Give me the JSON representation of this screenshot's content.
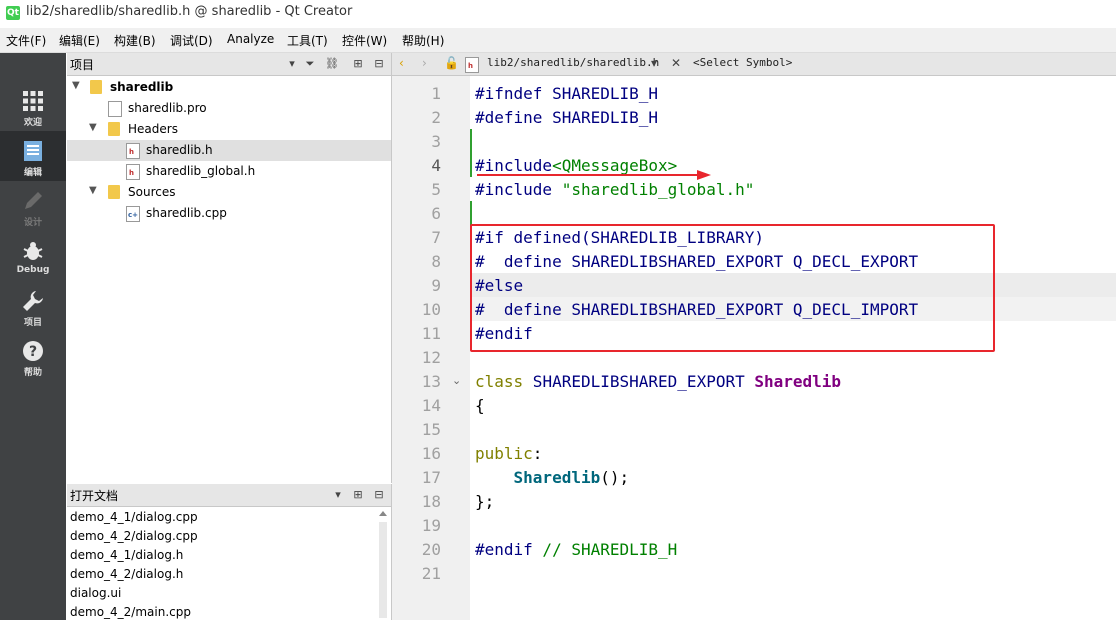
{
  "window": {
    "title": "lib2/sharedlib/sharedlib.h @ sharedlib - Qt Creator",
    "app_icon": "Qt"
  },
  "menu": [
    {
      "label": "文件(F)"
    },
    {
      "label": "编辑(E)"
    },
    {
      "label": "构建(B)"
    },
    {
      "label": "调试(D)"
    },
    {
      "label": "Analyze"
    },
    {
      "label": "工具(T)"
    },
    {
      "label": "控件(W)"
    },
    {
      "label": "帮助(H)"
    }
  ],
  "modes": [
    {
      "label": "欢迎",
      "icon": "grid-icon",
      "state": "normal"
    },
    {
      "label": "编辑",
      "icon": "edit-doc-icon",
      "state": "active"
    },
    {
      "label": "设计",
      "icon": "pencil-icon",
      "state": "disabled"
    },
    {
      "label": "Debug",
      "icon": "bug-icon",
      "state": "normal"
    },
    {
      "label": "项目",
      "icon": "wrench-icon",
      "state": "normal"
    },
    {
      "label": "帮助",
      "icon": "help-icon",
      "state": "normal"
    }
  ],
  "project_panel": {
    "title": "项目",
    "tree": [
      {
        "label": "sharedlib",
        "type": "project",
        "expanded": true
      },
      {
        "label": "sharedlib.pro",
        "type": "pro-file"
      },
      {
        "label": "Headers",
        "type": "folder",
        "expanded": true
      },
      {
        "label": "sharedlib.h",
        "type": "header-file",
        "selected": true
      },
      {
        "label": "sharedlib_global.h",
        "type": "header-file"
      },
      {
        "label": "Sources",
        "type": "folder",
        "expanded": true
      },
      {
        "label": "sharedlib.cpp",
        "type": "source-file"
      }
    ]
  },
  "open_docs_panel": {
    "title": "打开文档",
    "items": [
      {
        "label": "demo_4_1/dialog.cpp"
      },
      {
        "label": "demo_4_2/dialog.cpp"
      },
      {
        "label": "demo_4_1/dialog.h"
      },
      {
        "label": "demo_4_2/dialog.h"
      },
      {
        "label": "dialog.ui"
      },
      {
        "label": "demo_4_2/main.cpp"
      }
    ]
  },
  "editor_toolbar": {
    "file_path": "lib2/sharedlib/sharedlib.h",
    "symbol": "<Select Symbol>"
  },
  "editor": {
    "current_line": 4,
    "line_numbers": [
      "1",
      "2",
      "3",
      "4",
      "5",
      "6",
      "7",
      "8",
      "9",
      "10",
      "11",
      "12",
      "13",
      "14",
      "15",
      "16",
      "17",
      "18",
      "19",
      "20",
      "21"
    ],
    "lines": {
      "l1a": "#ifndef",
      "l1b": " SHAREDLIB_H",
      "l2a": "#define",
      "l2b": " SHAREDLIB_H",
      "l4a": "#include",
      "l4b": "<QMessageBox>",
      "l5a": "#include",
      "l5b": " \"sharedlib_global.h\"",
      "l7": "#if defined(SHAREDLIB_LIBRARY)",
      "l8a": "#  define",
      "l8b": " SHAREDLIBSHARED_EXPORT Q_DECL_EXPORT",
      "l9": "#else",
      "l10a": "#  define",
      "l10b": " SHAREDLIBSHARED_EXPORT Q_DECL_IMPORT",
      "l11": "#endif",
      "l13a": "class",
      "l13b": " SHAREDLIBSHARED_EXPORT ",
      "l13c": "Sharedlib",
      "l14": "{",
      "l16a": "public",
      "l16b": ":",
      "l17a": "    ",
      "l17b": "Sharedlib",
      "l17c": "();",
      "l18": "};",
      "l20a": "#endif",
      "l20b": " // SHAREDLIB_H"
    }
  },
  "colors": {
    "annotation_red": "#e8262d",
    "mode_bar": "#404244",
    "preprocessor": "#000080",
    "string": "#008000",
    "keyword": "#808000",
    "class_name": "#800080"
  }
}
